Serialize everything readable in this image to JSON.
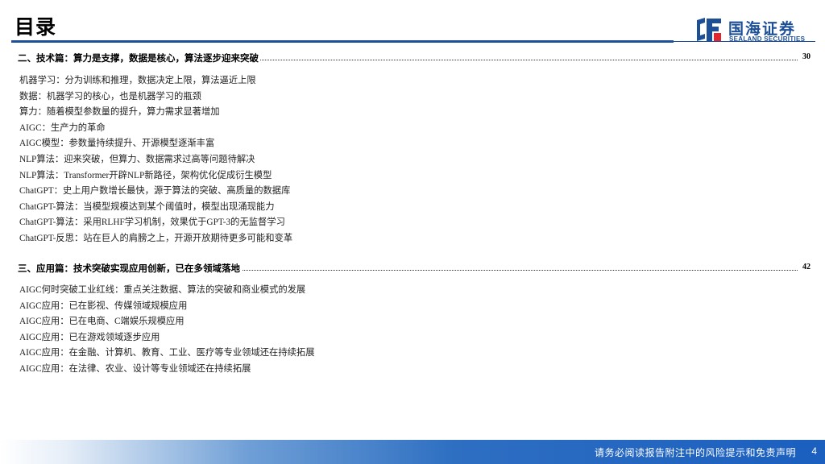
{
  "header": {
    "title": "目录",
    "logo_cn": "国海证券",
    "logo_en": "SEALAND SECURITIES",
    "accent_color": "#1c4f96"
  },
  "sections": [
    {
      "title": "二、技术篇：算力是支撑，数据是核心，算法逐步迎来突破",
      "page": "30",
      "items": [
        "机器学习：分为训练和推理，数据决定上限，算法逼近上限",
        "数据：机器学习的核心，也是机器学习的瓶颈",
        "算力：随着模型参数量的提升，算力需求显著增加",
        "AIGC：生产力的革命",
        "AIGC模型：参数量持续提升、开源模型逐渐丰富",
        "NLP算法：迎来突破，但算力、数据需求过高等问题待解决",
        "NLP算法：Transformer开辟NLP新路径，架构优化促成衍生模型",
        "ChatGPT：史上用户数增长最快，源于算法的突破、高质量的数据库",
        "ChatGPT-算法：当模型规模达到某个阈值时，模型出现涌现能力",
        "ChatGPT-算法：采用RLHF学习机制，效果优于GPT-3的无监督学习",
        "ChatGPT-反思：站在巨人的肩膀之上，开源开放期待更多可能和变革"
      ]
    },
    {
      "title": "三、应用篇：技术突破实现应用创新，已在多领域落地",
      "page": "42",
      "items": [
        "AIGC何时突破工业红线：重点关注数据、算法的突破和商业模式的发展",
        "AIGC应用：已在影视、传媒领域规模应用",
        "AIGC应用：已在电商、C端娱乐规模应用",
        "AIGC应用：已在游戏领域逐步应用",
        "AIGC应用：在金融、计算机、教育、工业、医疗等专业领域还在持续拓展",
        "AIGC应用：在法律、农业、设计等专业领域还在持续拓展"
      ]
    }
  ],
  "footer": {
    "disclaimer": "请务必阅读报告附注中的风险提示和免责声明",
    "page_number": "4"
  }
}
